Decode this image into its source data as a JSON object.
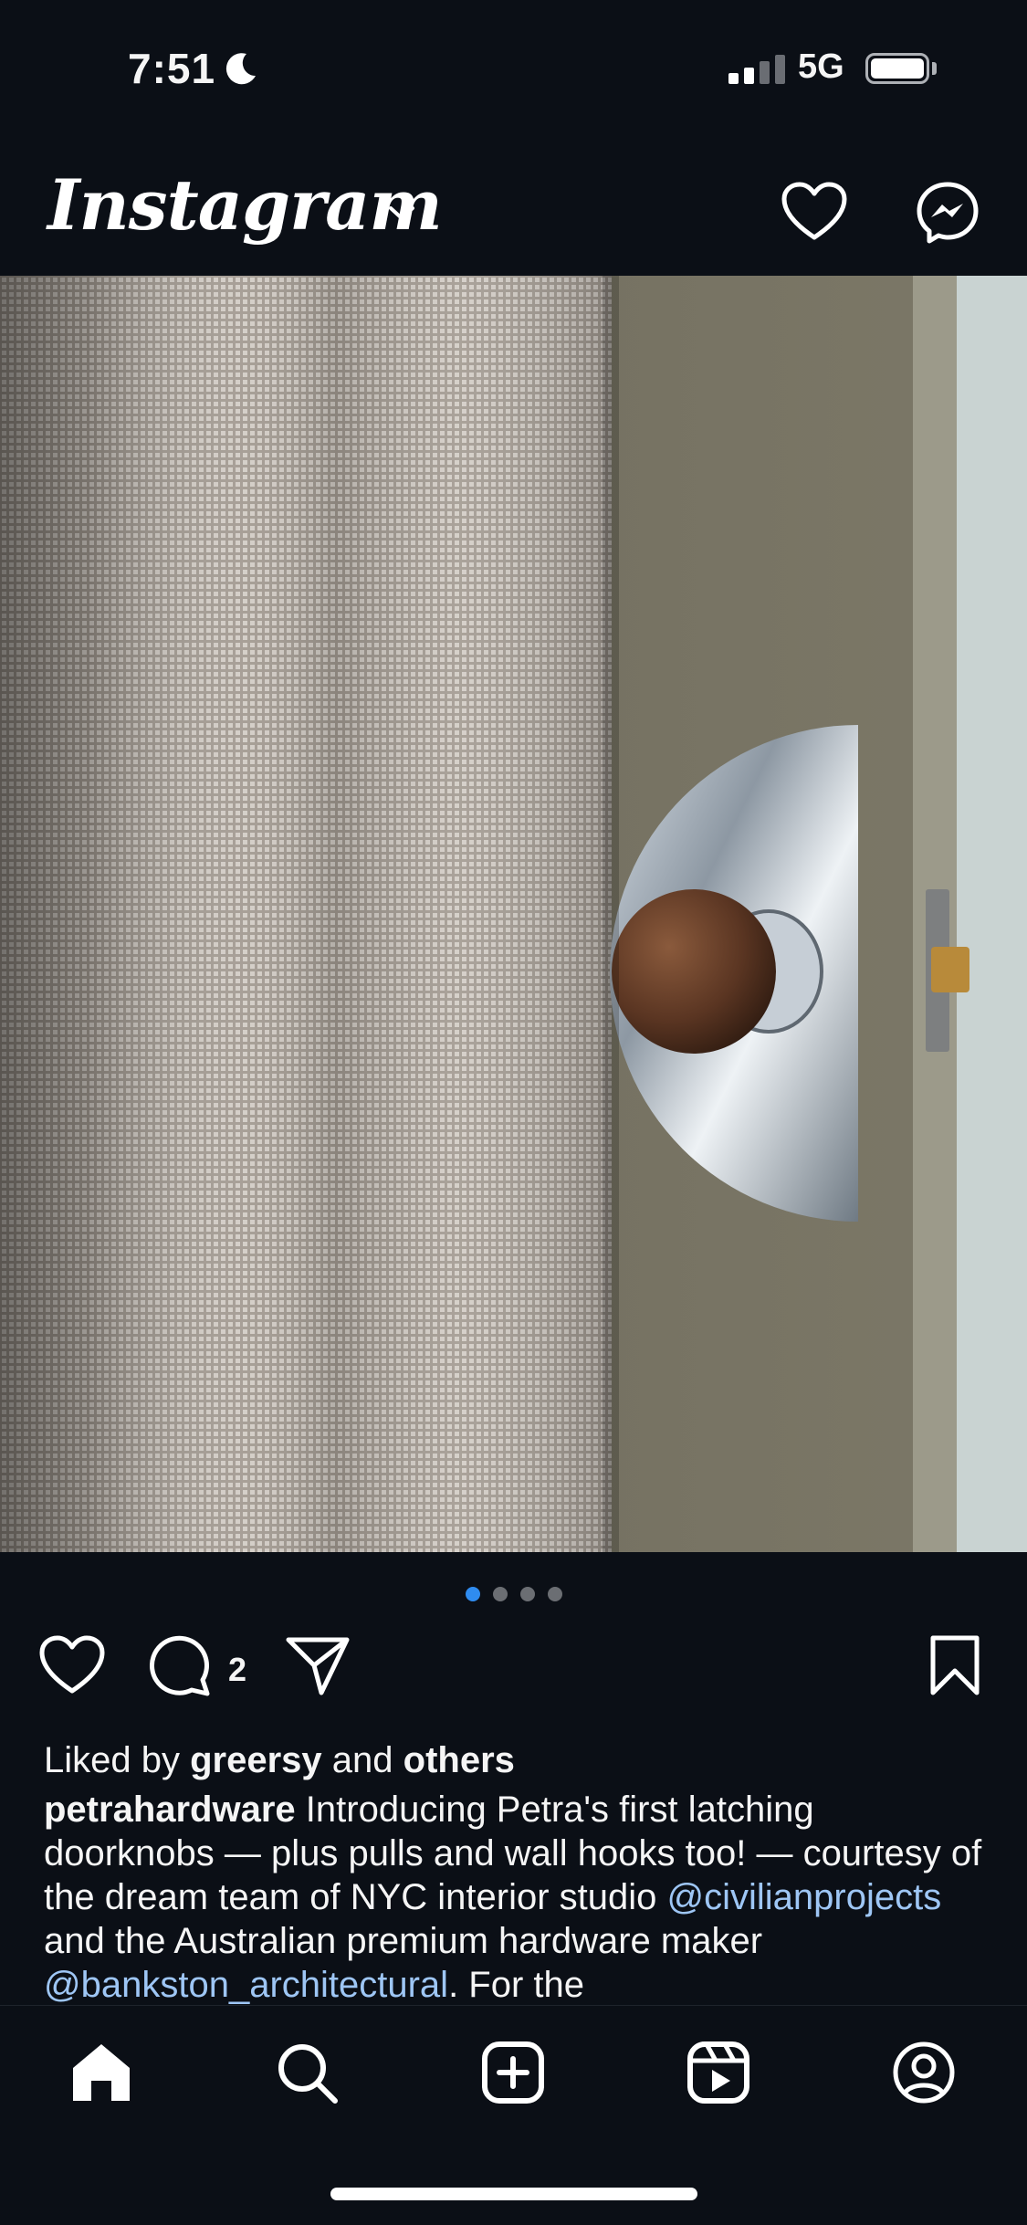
{
  "status_bar": {
    "time": "7:51",
    "network": "5G",
    "icons": [
      "moon-icon",
      "signal-icon",
      "battery-icon"
    ]
  },
  "header": {
    "logo": "Instagram",
    "icons": [
      "chevron-down-icon",
      "heart-icon",
      "messenger-icon"
    ]
  },
  "post": {
    "image_alt": "Chrome half-moon doorknob with walnut knob on olive door beside sheer curtain",
    "carousel": {
      "count": 4,
      "active": 1
    },
    "comment_count": "2",
    "liked_by": {
      "prefix": "Liked by",
      "user": "greersy",
      "middle": "and",
      "others": "others"
    },
    "caption": {
      "username": "petrahardware",
      "text1": " Introducing Petra's first latching doorknobs — plus pulls and wall hooks too! — courtesy of the dream team of NYC interior studio ",
      "mention1": "@civilianprojects",
      "text2": " and the Australian premium hardware maker ",
      "mention2": "@bankston_architectural",
      "text3": ". For the"
    }
  },
  "accent_colors": {
    "link": "#9ec6f5",
    "active_dot": "#2f8cf0",
    "background": "#0b0f16"
  },
  "nav": {
    "items": [
      "home-icon",
      "search-icon",
      "create-icon",
      "reels-icon",
      "profile-icon"
    ]
  }
}
